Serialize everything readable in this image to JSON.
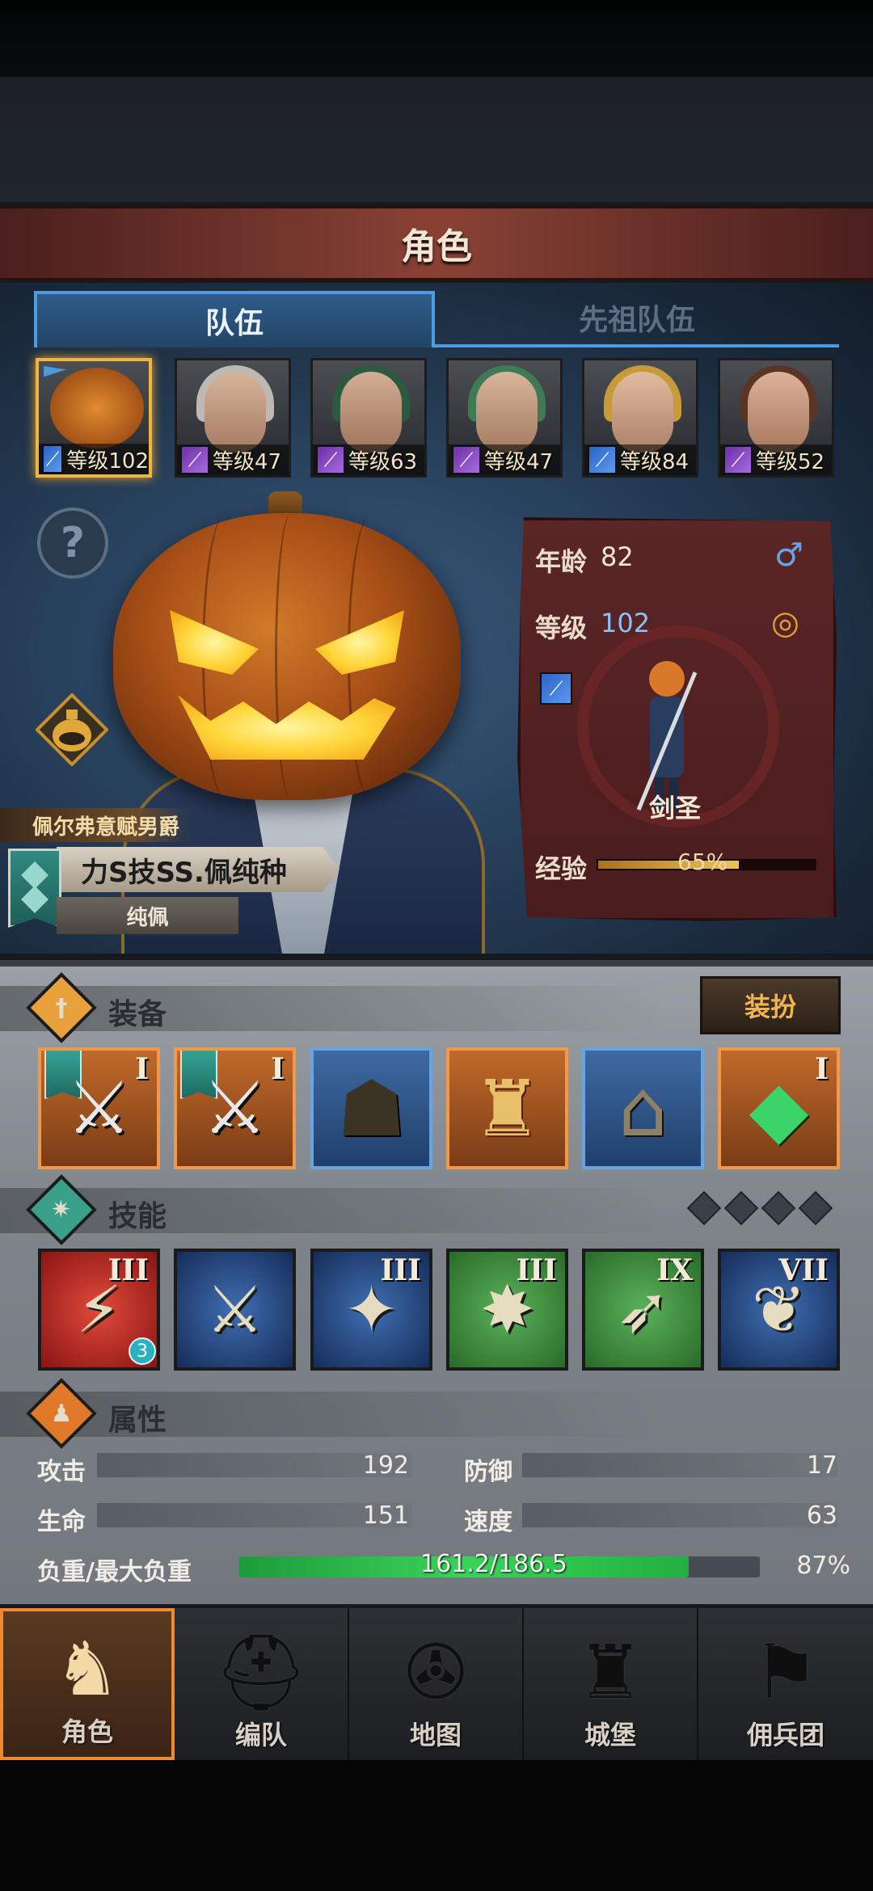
{
  "screen_title": "角色",
  "tabs": [
    {
      "label": "队伍",
      "active": true
    },
    {
      "label": "先祖队伍",
      "active": false
    }
  ],
  "party": [
    {
      "class": "sword",
      "level_label": "等级",
      "level": "102",
      "selected": true
    },
    {
      "class": "staff",
      "level_label": "等级",
      "level": "47"
    },
    {
      "class": "staff",
      "level_label": "等级",
      "level": "63"
    },
    {
      "class": "staff",
      "level_label": "等级",
      "level": "47"
    },
    {
      "class": "sword",
      "level_label": "等级",
      "level": "84"
    },
    {
      "class": "staff",
      "level_label": "等级",
      "level": "52"
    }
  ],
  "hero": {
    "title": "佩尔弗意赋男爵",
    "name": "力S技SS.佩纯种",
    "subtitle": "纯佩"
  },
  "card": {
    "age_label": "年龄",
    "age": "82",
    "level_label": "等级",
    "level": "102",
    "class_name": "剑圣",
    "exp_label": "经验",
    "exp_pct": 65,
    "exp_text": "65%"
  },
  "equipment": {
    "title": "装备",
    "dress_button": "装扮",
    "items": [
      {
        "name": "axe",
        "rank": "I",
        "flag": true,
        "tone": "orange",
        "glyph": "⚔"
      },
      {
        "name": "axe",
        "rank": "I",
        "flag": true,
        "tone": "orange",
        "glyph": "⚔"
      },
      {
        "name": "hood",
        "rank": "",
        "flag": false,
        "tone": "blue",
        "glyph": "☗"
      },
      {
        "name": "armor",
        "rank": "",
        "flag": false,
        "tone": "orange",
        "glyph": "♜"
      },
      {
        "name": "boots",
        "rank": "",
        "flag": false,
        "tone": "blue",
        "glyph": "⌂"
      },
      {
        "name": "crystal",
        "rank": "I",
        "flag": false,
        "tone": "orange",
        "glyph": "◆"
      }
    ]
  },
  "skills": {
    "title": "技能",
    "items": [
      {
        "rank": "III",
        "tone": "red",
        "glyph": "⚡",
        "badge": "3"
      },
      {
        "rank": "",
        "tone": "blue",
        "glyph": "⚔"
      },
      {
        "rank": "III",
        "tone": "blue",
        "glyph": "✦"
      },
      {
        "rank": "III",
        "tone": "green",
        "glyph": "✸"
      },
      {
        "rank": "IX",
        "tone": "green",
        "glyph": "➶"
      },
      {
        "rank": "VII",
        "tone": "blue",
        "glyph": "❦"
      }
    ]
  },
  "attributes": {
    "title": "属性",
    "attack_label": "攻击",
    "attack": "192",
    "defense_label": "防御",
    "defense": "17",
    "hp_label": "生命",
    "hp": "151",
    "speed_label": "速度",
    "speed": "63",
    "load_label": "负重/最大负重",
    "load_text": "161.2/186.5",
    "load_fraction": 0.864,
    "load_pct": "87%"
  },
  "nav": [
    {
      "label": "角色",
      "icon": "knight-icon",
      "active": true
    },
    {
      "label": "编队",
      "icon": "helmet-icon"
    },
    {
      "label": "地图",
      "icon": "compass-icon"
    },
    {
      "label": "城堡",
      "icon": "castle-icon"
    },
    {
      "label": "佣兵团",
      "icon": "mercenary-icon"
    }
  ],
  "colors": {
    "accent": "#f0b53c",
    "tab_blue": "#4d9be0",
    "load_green": "#2fbd4a"
  }
}
